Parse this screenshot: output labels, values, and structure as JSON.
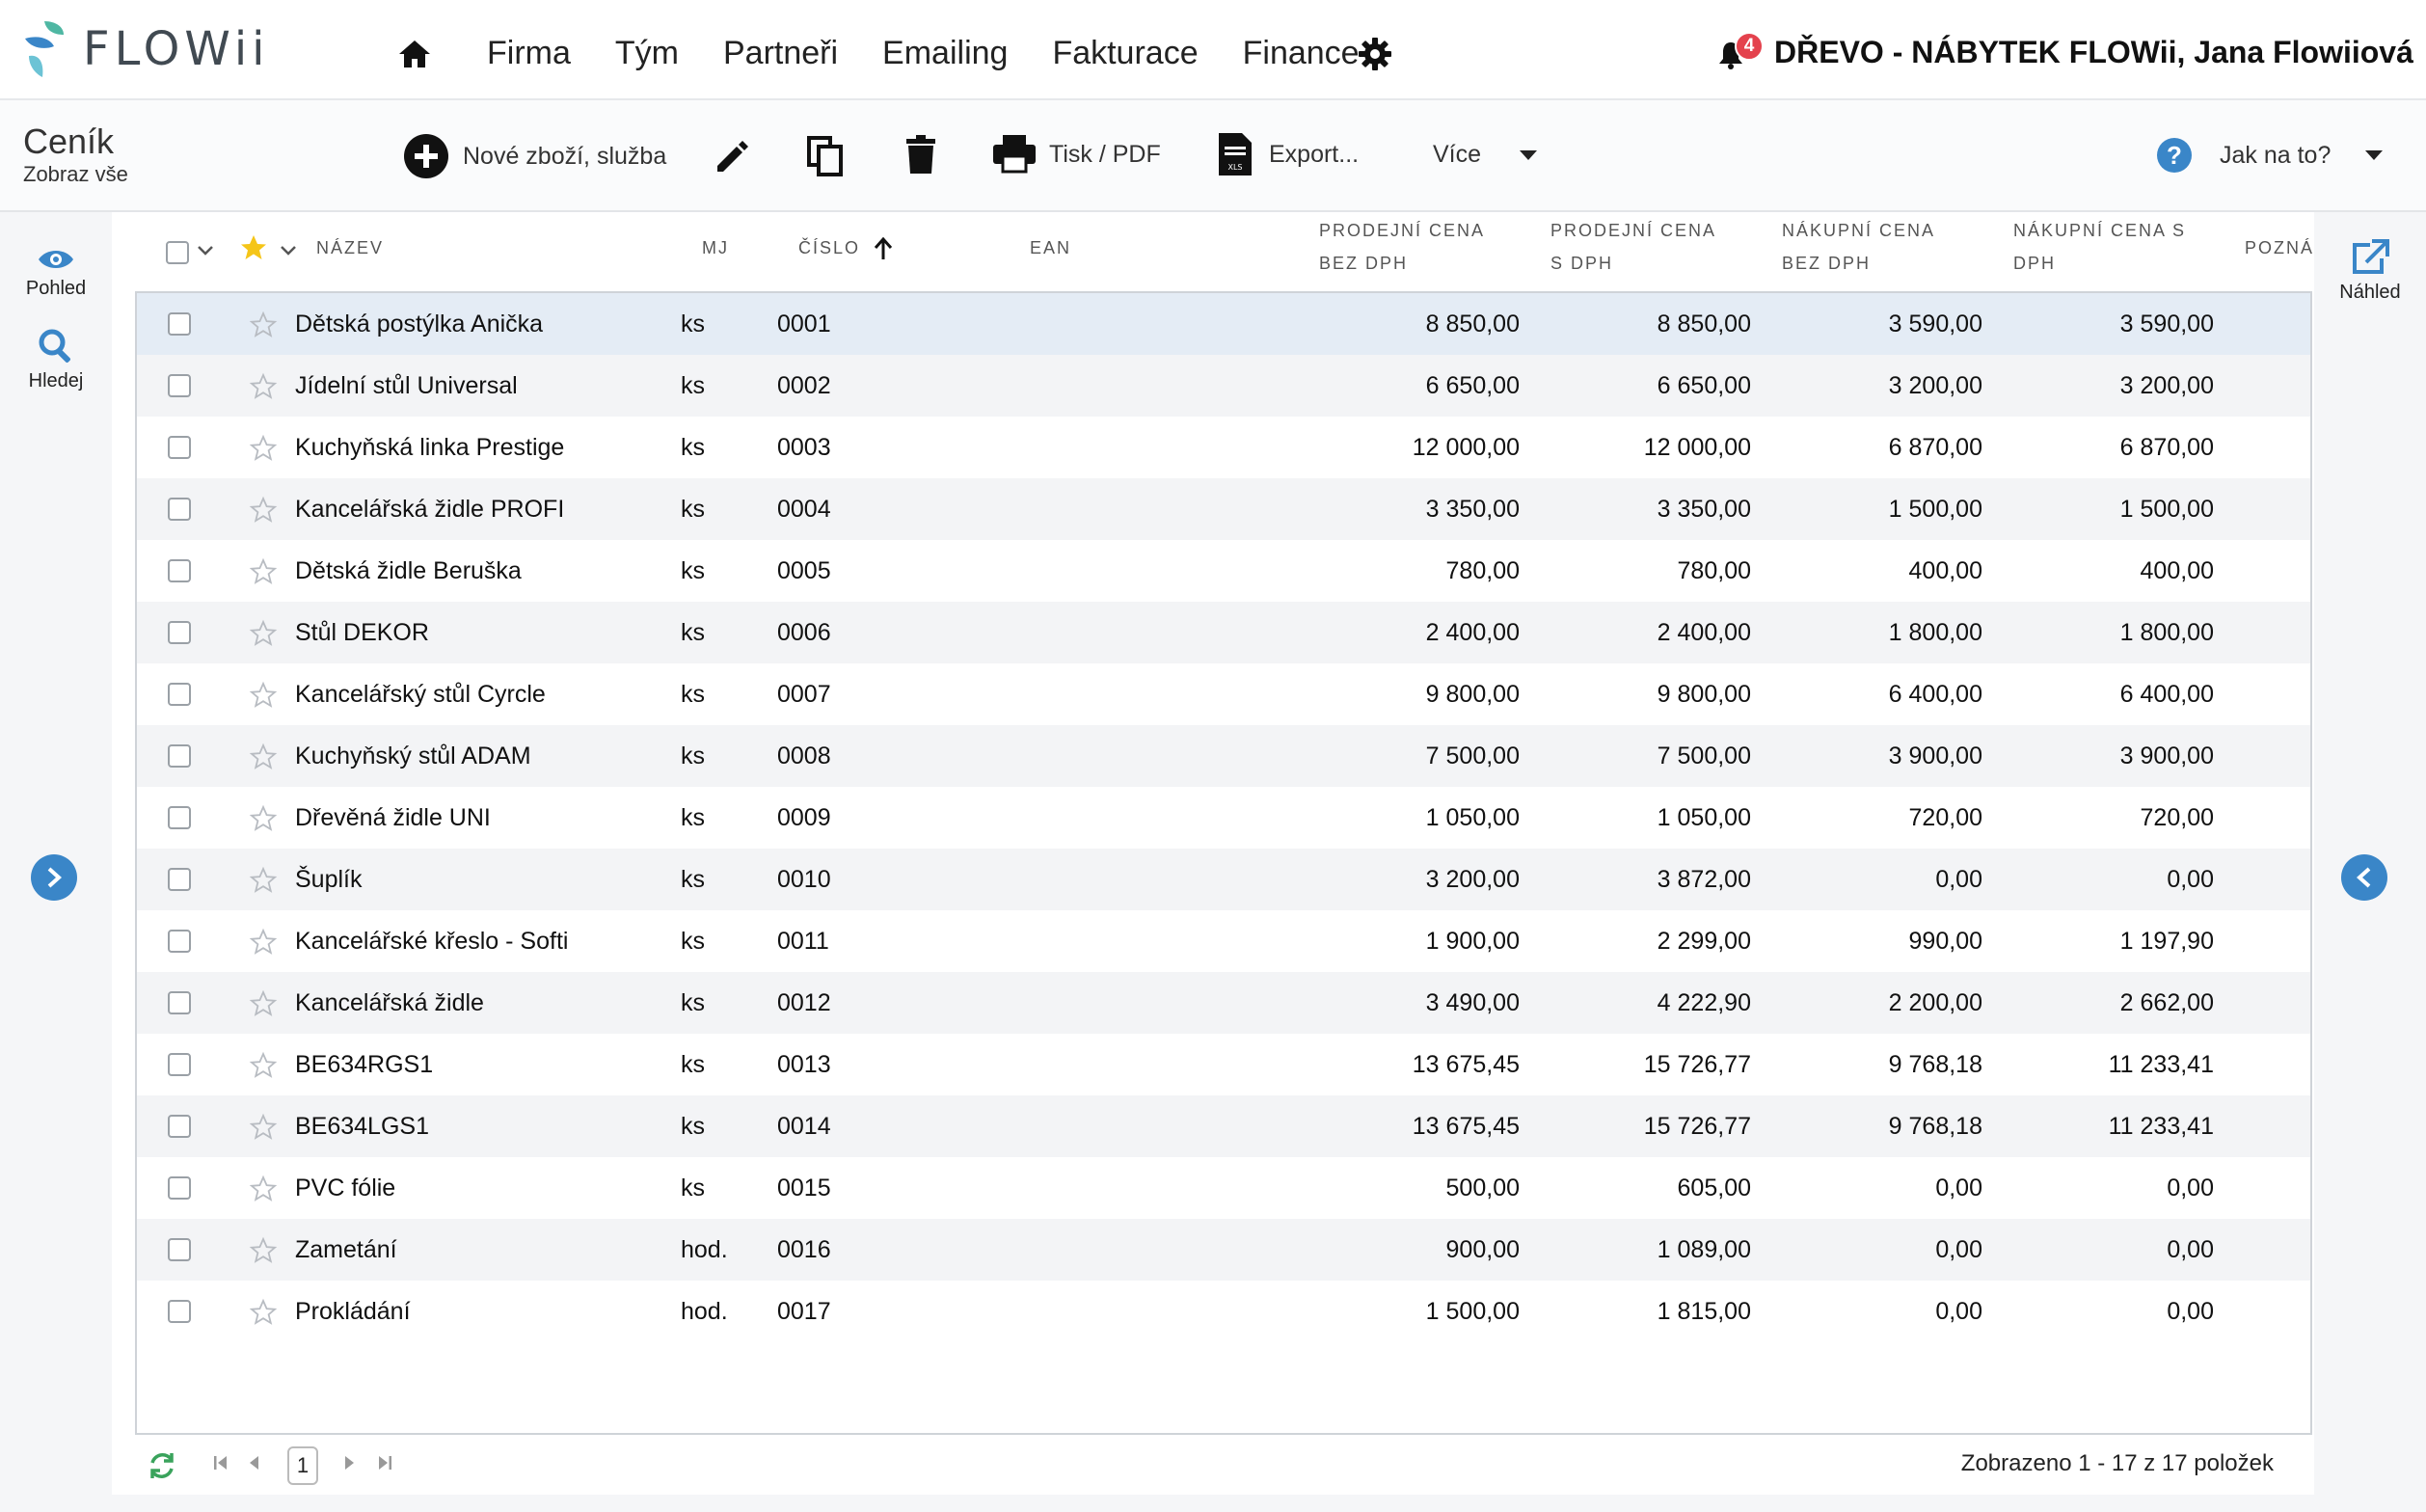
{
  "app": {
    "logo_text": "FLOWii",
    "nav": [
      "Firma",
      "Tým",
      "Partneři",
      "Emailing",
      "Fakturace",
      "Finance"
    ],
    "notification_count": "4",
    "company_user": "DŘEVO - NÁBYTEK FLOWii, Jana Flowiiová"
  },
  "toolbar": {
    "title": "Ceník",
    "subtitle": "Zobraz vše",
    "new_label": "Nové zboží, služba",
    "print_label": "Tisk / PDF",
    "export_label": "Export...",
    "more_label": "Více",
    "help_label": "Jak na to?",
    "xls_label": "XLS"
  },
  "side": {
    "view_label": "Pohled",
    "search_label": "Hledej",
    "preview_label": "Náhled"
  },
  "columns": {
    "name": "Název",
    "unit": "MJ",
    "number": "Číslo",
    "ean": "EAN",
    "sell_no_vat_1": "Prodejní cena",
    "sell_no_vat_2": "bez DPH",
    "sell_vat_1": "Prodejní cena",
    "sell_vat_2": "s DPH",
    "buy_no_vat_1": "Nákupní cena",
    "buy_no_vat_2": "bez DPH",
    "buy_vat_1": "Nákupní cena s",
    "buy_vat_2": "DPH",
    "note": "Pozná"
  },
  "rows": [
    {
      "name": "Dětská postýlka Anička",
      "unit": "ks",
      "number": "0001",
      "ean": "",
      "sell": "8 850,00",
      "sell_vat": "8 850,00",
      "buy": "3 590,00",
      "buy_vat": "3 590,00"
    },
    {
      "name": "Jídelní stůl Universal",
      "unit": "ks",
      "number": "0002",
      "ean": "",
      "sell": "6 650,00",
      "sell_vat": "6 650,00",
      "buy": "3 200,00",
      "buy_vat": "3 200,00"
    },
    {
      "name": "Kuchyňská linka Prestige",
      "unit": "ks",
      "number": "0003",
      "ean": "",
      "sell": "12 000,00",
      "sell_vat": "12 000,00",
      "buy": "6 870,00",
      "buy_vat": "6 870,00"
    },
    {
      "name": "Kancelářská židle PROFI",
      "unit": "ks",
      "number": "0004",
      "ean": "",
      "sell": "3 350,00",
      "sell_vat": "3 350,00",
      "buy": "1 500,00",
      "buy_vat": "1 500,00"
    },
    {
      "name": "Dětská židle Beruška",
      "unit": "ks",
      "number": "0005",
      "ean": "",
      "sell": "780,00",
      "sell_vat": "780,00",
      "buy": "400,00",
      "buy_vat": "400,00"
    },
    {
      "name": "Stůl DEKOR",
      "unit": "ks",
      "number": "0006",
      "ean": "",
      "sell": "2 400,00",
      "sell_vat": "2 400,00",
      "buy": "1 800,00",
      "buy_vat": "1 800,00"
    },
    {
      "name": "Kancelářský stůl Cyrcle",
      "unit": "ks",
      "number": "0007",
      "ean": "",
      "sell": "9 800,00",
      "sell_vat": "9 800,00",
      "buy": "6 400,00",
      "buy_vat": "6 400,00"
    },
    {
      "name": "Kuchyňský stůl ADAM",
      "unit": "ks",
      "number": "0008",
      "ean": "",
      "sell": "7 500,00",
      "sell_vat": "7 500,00",
      "buy": "3 900,00",
      "buy_vat": "3 900,00"
    },
    {
      "name": "Dřevěná židle UNI",
      "unit": "ks",
      "number": "0009",
      "ean": "",
      "sell": "1 050,00",
      "sell_vat": "1 050,00",
      "buy": "720,00",
      "buy_vat": "720,00"
    },
    {
      "name": "Šuplík",
      "unit": "ks",
      "number": "0010",
      "ean": "",
      "sell": "3 200,00",
      "sell_vat": "3 872,00",
      "buy": "0,00",
      "buy_vat": "0,00"
    },
    {
      "name": "Kancelářské křeslo - Softi",
      "unit": "ks",
      "number": "0011",
      "ean": "",
      "sell": "1 900,00",
      "sell_vat": "2 299,00",
      "buy": "990,00",
      "buy_vat": "1 197,90"
    },
    {
      "name": "Kancelářská židle",
      "unit": "ks",
      "number": "0012",
      "ean": "",
      "sell": "3 490,00",
      "sell_vat": "4 222,90",
      "buy": "2 200,00",
      "buy_vat": "2 662,00"
    },
    {
      "name": "BE634RGS1",
      "unit": "ks",
      "number": "0013",
      "ean": "",
      "sell": "13 675,45",
      "sell_vat": "15 726,77",
      "buy": "9 768,18",
      "buy_vat": "11 233,41"
    },
    {
      "name": "BE634LGS1",
      "unit": "ks",
      "number": "0014",
      "ean": "",
      "sell": "13 675,45",
      "sell_vat": "15 726,77",
      "buy": "9 768,18",
      "buy_vat": "11 233,41"
    },
    {
      "name": "PVC fólie",
      "unit": "ks",
      "number": "0015",
      "ean": "",
      "sell": "500,00",
      "sell_vat": "605,00",
      "buy": "0,00",
      "buy_vat": "0,00"
    },
    {
      "name": "Zametání",
      "unit": "hod.",
      "number": "0016",
      "ean": "",
      "sell": "900,00",
      "sell_vat": "1 089,00",
      "buy": "0,00",
      "buy_vat": "0,00"
    },
    {
      "name": "Prokládání",
      "unit": "hod.",
      "number": "0017",
      "ean": "",
      "sell": "1 500,00",
      "sell_vat": "1 815,00",
      "buy": "0,00",
      "buy_vat": "0,00"
    }
  ],
  "selected_row": 0,
  "pager": {
    "current_page": "1",
    "info": "Zobrazeno 1 - 17 z 17 položek"
  },
  "colors": {
    "accent": "#3a86c8",
    "badge": "#e4424d",
    "star_active": "#f5c518"
  },
  "icons": [
    "home-icon",
    "gear-icon",
    "bell-icon",
    "plus-circle-icon",
    "pencil-icon",
    "copy-icon",
    "trash-icon",
    "printer-icon",
    "xls-file-icon",
    "help-icon",
    "eye-icon",
    "search-icon",
    "star-icon",
    "external-link-icon",
    "chevron-right-icon",
    "chevron-left-icon",
    "refresh-icon"
  ]
}
